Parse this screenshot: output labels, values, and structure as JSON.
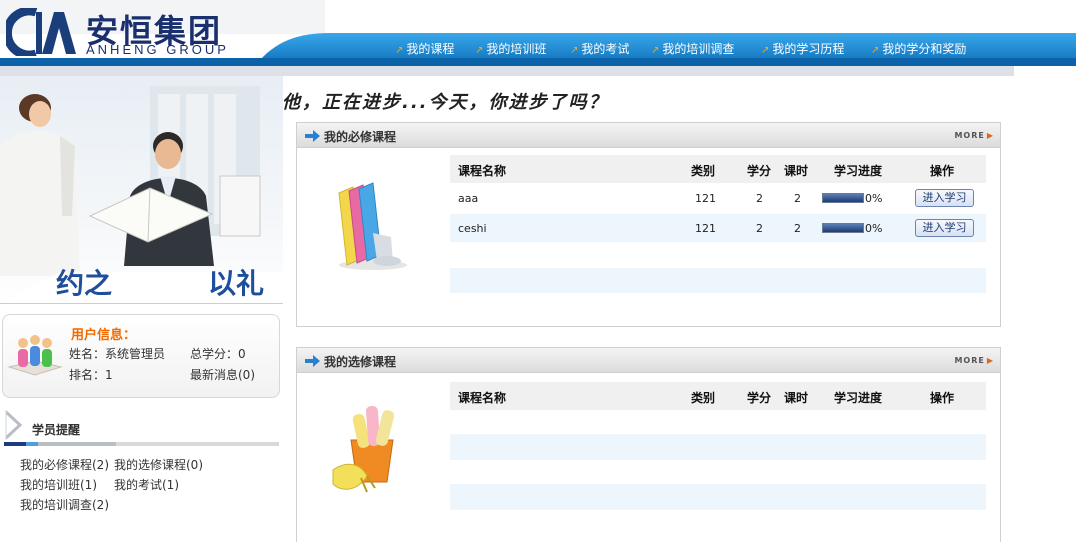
{
  "brand": {
    "name_cn": "安恒集团",
    "name_en": "ANHENG GROUP"
  },
  "nav": [
    {
      "label": "我的课程"
    },
    {
      "label": "我的培训班"
    },
    {
      "label": "我的考试"
    },
    {
      "label": "我的培训调查"
    },
    {
      "label": "我的学习历程"
    },
    {
      "label": "我的学分和奖励"
    }
  ],
  "slogan": "他，正在进步...今天，你进步了吗？",
  "banner": {
    "caption_left": "约之",
    "caption_right": "以礼"
  },
  "user_info": {
    "title": "用户信息：",
    "name_line": "姓名：系统管理员",
    "rank_line": "排名：1",
    "credit_line": "总学分：0",
    "message_line": "最新消息(0)"
  },
  "reminders": {
    "title": "学员提醒",
    "items": [
      {
        "label": "我的必修课程(2)"
      },
      {
        "label": "我的选修课程(0)"
      },
      {
        "label": "我的培训班(1)"
      },
      {
        "label": "我的考试(1)"
      },
      {
        "label": "我的培训调查(2)"
      }
    ]
  },
  "table_headers": {
    "name": "课程名称",
    "type": "类别",
    "credit": "学分",
    "hours": "课时",
    "progress": "学习进度",
    "action": "操作"
  },
  "required": {
    "title": "我的必修课程",
    "more": "MORE",
    "rows": [
      {
        "name": "aaa",
        "type": "121",
        "credit": "2",
        "hours": "2",
        "progress": "0%",
        "action": "进入学习",
        "progress_fraction": 0
      },
      {
        "name": "ceshi",
        "type": "121",
        "credit": "2",
        "hours": "2",
        "progress": "0%",
        "action": "进入学习",
        "progress_fraction": 0
      }
    ]
  },
  "elective": {
    "title": "我的选修课程",
    "more": "MORE",
    "rows": []
  },
  "colors": {
    "nav_bar": "#1a8ad4",
    "brand_blue": "#1a2f6e",
    "user_title": "#ef6a00",
    "row_alt": "#edf6fc"
  }
}
